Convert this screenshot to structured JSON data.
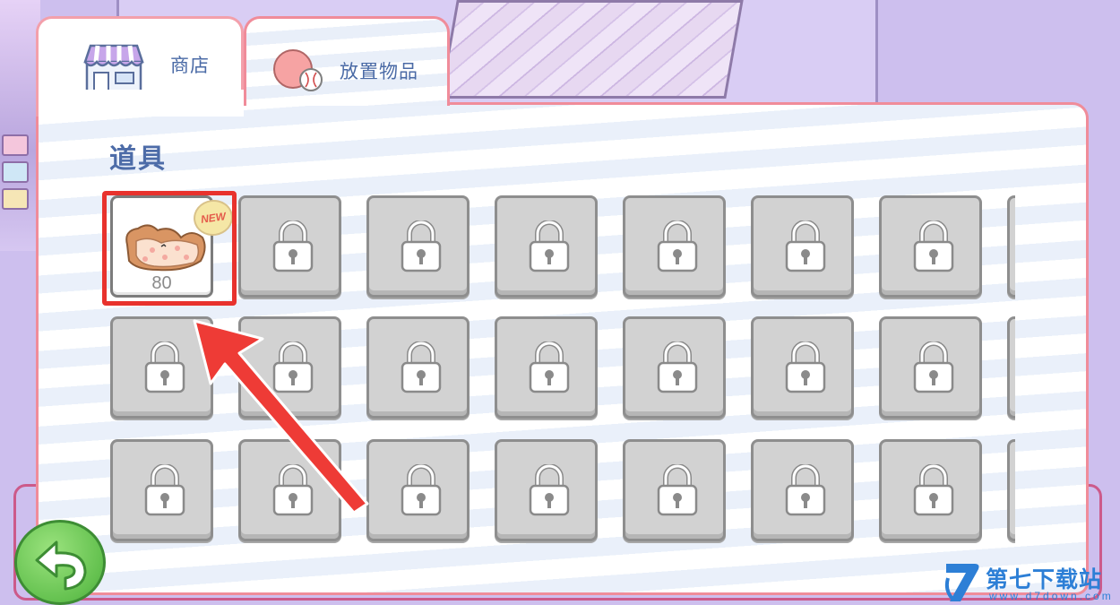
{
  "tabs": [
    {
      "label": "商店",
      "icon": "shop-icon",
      "active": true
    },
    {
      "label": "放置物品",
      "icon": "ball-icon",
      "active": false
    }
  ],
  "section": {
    "title": "道具"
  },
  "items": [
    {
      "price": "80",
      "badge": "NEW",
      "icon": "bread-pillow-icon",
      "locked": false
    }
  ],
  "locked_slot_icon": "lock-icon",
  "watermark": {
    "title": "第七下载站",
    "url": "www.d7down.com"
  },
  "colors": {
    "accent": "#f08c9a",
    "title": "#4d6ca8",
    "highlight": "#e8322d",
    "back_button": "#64c14f"
  }
}
